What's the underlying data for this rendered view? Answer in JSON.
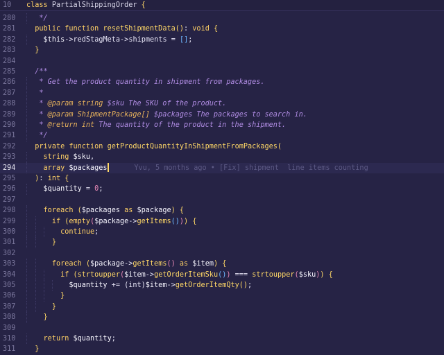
{
  "editor": {
    "sticky": {
      "line_no": "10",
      "text": "class PartialShippingOrder {"
    },
    "blame": "Yvu, 5 months ago • [Fix] shipment  line items counting",
    "lines": [
      {
        "n": "280",
        "t": "   */"
      },
      {
        "n": "281",
        "t": "  public function resetShipmentData(): void {"
      },
      {
        "n": "282",
        "t": "    $this->redStagMeta->shipments = [];"
      },
      {
        "n": "283",
        "t": "  }"
      },
      {
        "n": "284",
        "t": ""
      },
      {
        "n": "285",
        "t": "  /**"
      },
      {
        "n": "286",
        "t": "   * Get the product quantity in shipment from packages."
      },
      {
        "n": "287",
        "t": "   *"
      },
      {
        "n": "288",
        "t": "   * @param string $sku The SKU of the product."
      },
      {
        "n": "289",
        "t": "   * @param ShipmentPackage[] $packages The packages to search in."
      },
      {
        "n": "290",
        "t": "   * @return int The quantity of the product in the shipment."
      },
      {
        "n": "291",
        "t": "   */"
      },
      {
        "n": "292",
        "t": "  private function getProductQuantityInShipmentFromPackages("
      },
      {
        "n": "293",
        "t": "    string $sku,"
      },
      {
        "n": "294",
        "t": "    array $packages"
      },
      {
        "n": "295",
        "t": "  ): int {"
      },
      {
        "n": "296",
        "t": "    $quantity = 0;"
      },
      {
        "n": "297",
        "t": ""
      },
      {
        "n": "298",
        "t": "    foreach ($packages as $package) {"
      },
      {
        "n": "299",
        "t": "      if (empty($package->getItems())) {"
      },
      {
        "n": "300",
        "t": "        continue;"
      },
      {
        "n": "301",
        "t": "      }"
      },
      {
        "n": "302",
        "t": ""
      },
      {
        "n": "303",
        "t": "      foreach ($package->getItems() as $item) {"
      },
      {
        "n": "304",
        "t": "        if (strtoupper($item->getOrderItemSku()) === strtoupper($sku)) {"
      },
      {
        "n": "305",
        "t": "          $quantity += (int)$item->getOrderItemQty();"
      },
      {
        "n": "306",
        "t": "        }"
      },
      {
        "n": "307",
        "t": "      }"
      },
      {
        "n": "308",
        "t": "    }"
      },
      {
        "n": "309",
        "t": ""
      },
      {
        "n": "310",
        "t": "    return $quantity;"
      },
      {
        "n": "311",
        "t": "  }"
      }
    ]
  }
}
